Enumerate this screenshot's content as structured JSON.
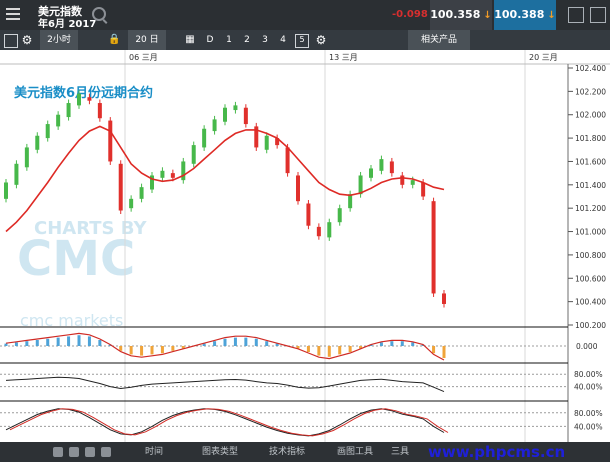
{
  "window": {
    "title_line1": "美元指数",
    "title_line2": "年6月 2017",
    "change": "-0.098",
    "sell_price": "100.358",
    "buy_price": "100.388",
    "sell_arrow": "↓",
    "buy_arrow": "↓"
  },
  "toolbar": {
    "interval": "2小时",
    "bars": "20 日",
    "d": "D",
    "n1": "1",
    "n2": "2",
    "n3": "3",
    "n4": "4",
    "n5": "5",
    "related": "相关产品"
  },
  "footer": {
    "time": "时间",
    "chart_type": "图表类型",
    "tech_indicators": "技术指标",
    "drawing_tools": "画图工具",
    "tools": "三具",
    "link": "www.phpcms.cn"
  },
  "chart_data": {
    "type": "candlestick",
    "title": "美元指数6月份远期合约",
    "watermark": "CHARTS BY",
    "watermark_brand": "cmc markets",
    "date_labels": [
      "06 三月",
      "13 三月",
      "20 三月"
    ],
    "price_ticks": [
      "102.400",
      "102.200",
      "102.000",
      "101.800",
      "101.600",
      "101.400",
      "101.200",
      "101.000",
      "100.800",
      "100.600",
      "100.400",
      "100.200"
    ],
    "ylim": [
      100.2,
      102.4
    ],
    "candles": [
      {
        "o": 101.28,
        "c": 101.42
      },
      {
        "o": 101.4,
        "c": 101.58
      },
      {
        "o": 101.55,
        "c": 101.72
      },
      {
        "o": 101.7,
        "c": 101.82
      },
      {
        "o": 101.8,
        "c": 101.92
      },
      {
        "o": 101.9,
        "c": 102.0
      },
      {
        "o": 101.98,
        "c": 102.1
      },
      {
        "o": 102.08,
        "c": 102.18
      },
      {
        "o": 102.15,
        "c": 102.12
      },
      {
        "o": 102.1,
        "c": 101.97
      },
      {
        "o": 101.95,
        "c": 101.6
      },
      {
        "o": 101.58,
        "c": 101.18
      },
      {
        "o": 101.2,
        "c": 101.28
      },
      {
        "o": 101.28,
        "c": 101.38
      },
      {
        "o": 101.36,
        "c": 101.48
      },
      {
        "o": 101.46,
        "c": 101.52
      },
      {
        "o": 101.5,
        "c": 101.46
      },
      {
        "o": 101.44,
        "c": 101.6
      },
      {
        "o": 101.58,
        "c": 101.74
      },
      {
        "o": 101.72,
        "c": 101.88
      },
      {
        "o": 101.86,
        "c": 101.96
      },
      {
        "o": 101.94,
        "c": 102.06
      },
      {
        "o": 102.04,
        "c": 102.08
      },
      {
        "o": 102.06,
        "c": 101.92
      },
      {
        "o": 101.9,
        "c": 101.72
      },
      {
        "o": 101.7,
        "c": 101.82
      },
      {
        "o": 101.8,
        "c": 101.74
      },
      {
        "o": 101.72,
        "c": 101.5
      },
      {
        "o": 101.48,
        "c": 101.26
      },
      {
        "o": 101.24,
        "c": 101.05
      },
      {
        "o": 101.04,
        "c": 100.96
      },
      {
        "o": 100.95,
        "c": 101.08
      },
      {
        "o": 101.08,
        "c": 101.2
      },
      {
        "o": 101.2,
        "c": 101.32
      },
      {
        "o": 101.32,
        "c": 101.48
      },
      {
        "o": 101.46,
        "c": 101.54
      },
      {
        "o": 101.52,
        "c": 101.62
      },
      {
        "o": 101.6,
        "c": 101.5
      },
      {
        "o": 101.48,
        "c": 101.4
      },
      {
        "o": 101.4,
        "c": 101.44
      },
      {
        "o": 101.42,
        "c": 101.3
      },
      {
        "o": 101.26,
        "c": 100.47
      },
      {
        "o": 100.47,
        "c": 100.38
      }
    ],
    "ma": [
      101.0,
      101.08,
      101.18,
      101.3,
      101.42,
      101.55,
      101.67,
      101.78,
      101.86,
      101.9,
      101.86,
      101.72,
      101.58,
      101.5,
      101.45,
      101.43,
      101.44,
      101.48,
      101.54,
      101.62,
      101.7,
      101.78,
      101.84,
      101.87,
      101.87,
      101.84,
      101.8,
      101.72,
      101.62,
      101.52,
      101.42,
      101.36,
      101.32,
      101.31,
      101.33,
      101.37,
      101.42,
      101.45,
      101.46,
      101.45,
      101.42,
      101.38,
      101.36
    ],
    "indicators": {
      "macd_tick": "0.000",
      "rsi_ticks": [
        "80.00%",
        "40.00%"
      ],
      "stoch_ticks": [
        "80.00%",
        "40.00%"
      ]
    },
    "macd_hist": [
      0.02,
      0.03,
      0.04,
      0.05,
      0.06,
      0.07,
      0.08,
      0.09,
      0.08,
      0.05,
      0.01,
      -0.04,
      -0.07,
      -0.08,
      -0.07,
      -0.06,
      -0.04,
      -0.02,
      0.0,
      0.02,
      0.04,
      0.06,
      0.07,
      0.07,
      0.06,
      0.04,
      0.02,
      0.0,
      -0.02,
      -0.05,
      -0.08,
      -0.09,
      -0.07,
      -0.05,
      -0.02,
      0.01,
      0.03,
      0.04,
      0.04,
      0.03,
      0.01,
      -0.06,
      -0.1
    ],
    "rsi": [
      60,
      62,
      64,
      66,
      68,
      70,
      69,
      66,
      58,
      50,
      40,
      34,
      38,
      44,
      48,
      50,
      52,
      54,
      56,
      58,
      60,
      62,
      63,
      61,
      56,
      52,
      50,
      45,
      38,
      35,
      36,
      42,
      48,
      54,
      60,
      62,
      64,
      60,
      56,
      54,
      52,
      38,
      24
    ],
    "stoch": [
      30,
      45,
      60,
      75,
      85,
      92,
      90,
      82,
      66,
      48,
      30,
      18,
      15,
      24,
      40,
      58,
      72,
      82,
      88,
      92,
      90,
      84,
      74,
      62,
      50,
      38,
      28,
      20,
      15,
      12,
      18,
      28,
      44,
      62,
      78,
      88,
      92,
      86,
      76,
      70,
      62,
      40,
      22
    ]
  }
}
